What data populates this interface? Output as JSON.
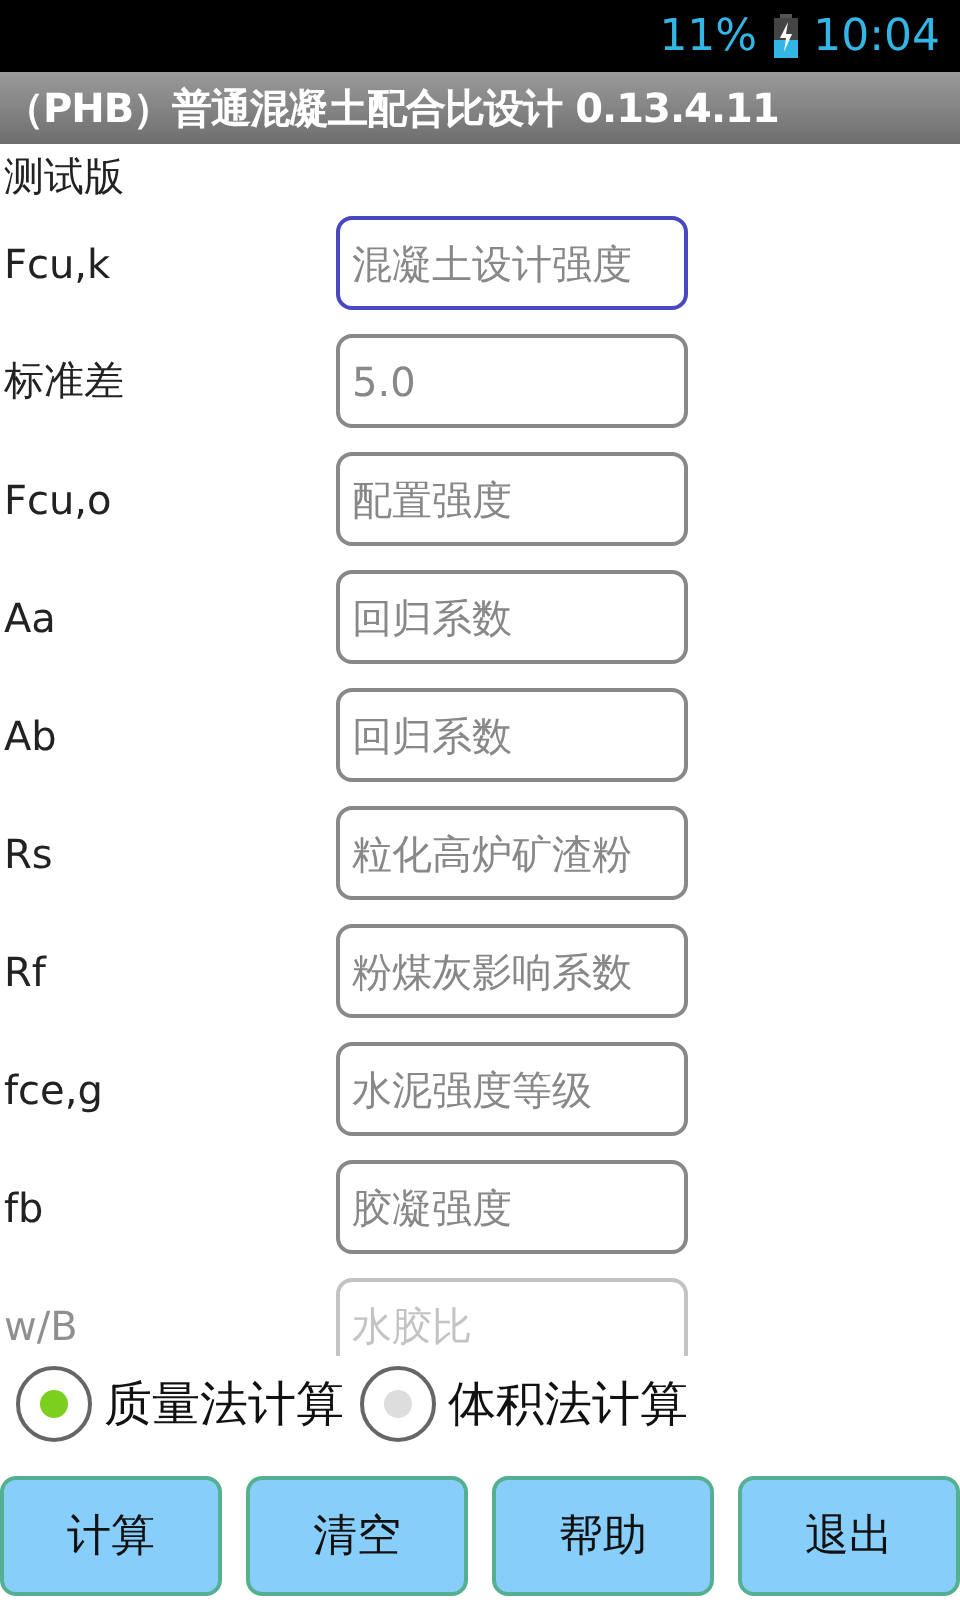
{
  "status_bar": {
    "battery": "11%",
    "time": "10:04"
  },
  "title_bar": {
    "title": "（PHB）普通混凝土配合比设计 0.13.4.11"
  },
  "subtitle": "测试版",
  "fields": [
    {
      "label": "Fcu,k",
      "placeholder": "混凝土设计强度",
      "focused": true
    },
    {
      "label": "标准差",
      "placeholder": "5.0",
      "focused": false
    },
    {
      "label": "Fcu,o",
      "placeholder": "配置强度",
      "focused": false
    },
    {
      "label": "Aa",
      "placeholder": "回归系数",
      "focused": false
    },
    {
      "label": "Ab",
      "placeholder": "回归系数",
      "focused": false
    },
    {
      "label": "Rs",
      "placeholder": "粒化高炉矿渣粉",
      "focused": false
    },
    {
      "label": "Rf",
      "placeholder": "粉煤灰影响系数",
      "focused": false
    },
    {
      "label": "fce,g",
      "placeholder": "水泥强度等级",
      "focused": false
    },
    {
      "label": "fb",
      "placeholder": "胶凝强度",
      "focused": false
    },
    {
      "label": "w/B",
      "placeholder": "水胶比",
      "focused": false
    }
  ],
  "methods": [
    {
      "label": "质量法计算",
      "selected": true
    },
    {
      "label": "体积法计算",
      "selected": false
    }
  ],
  "buttons": [
    "计算",
    "清空",
    "帮助",
    "退出"
  ]
}
